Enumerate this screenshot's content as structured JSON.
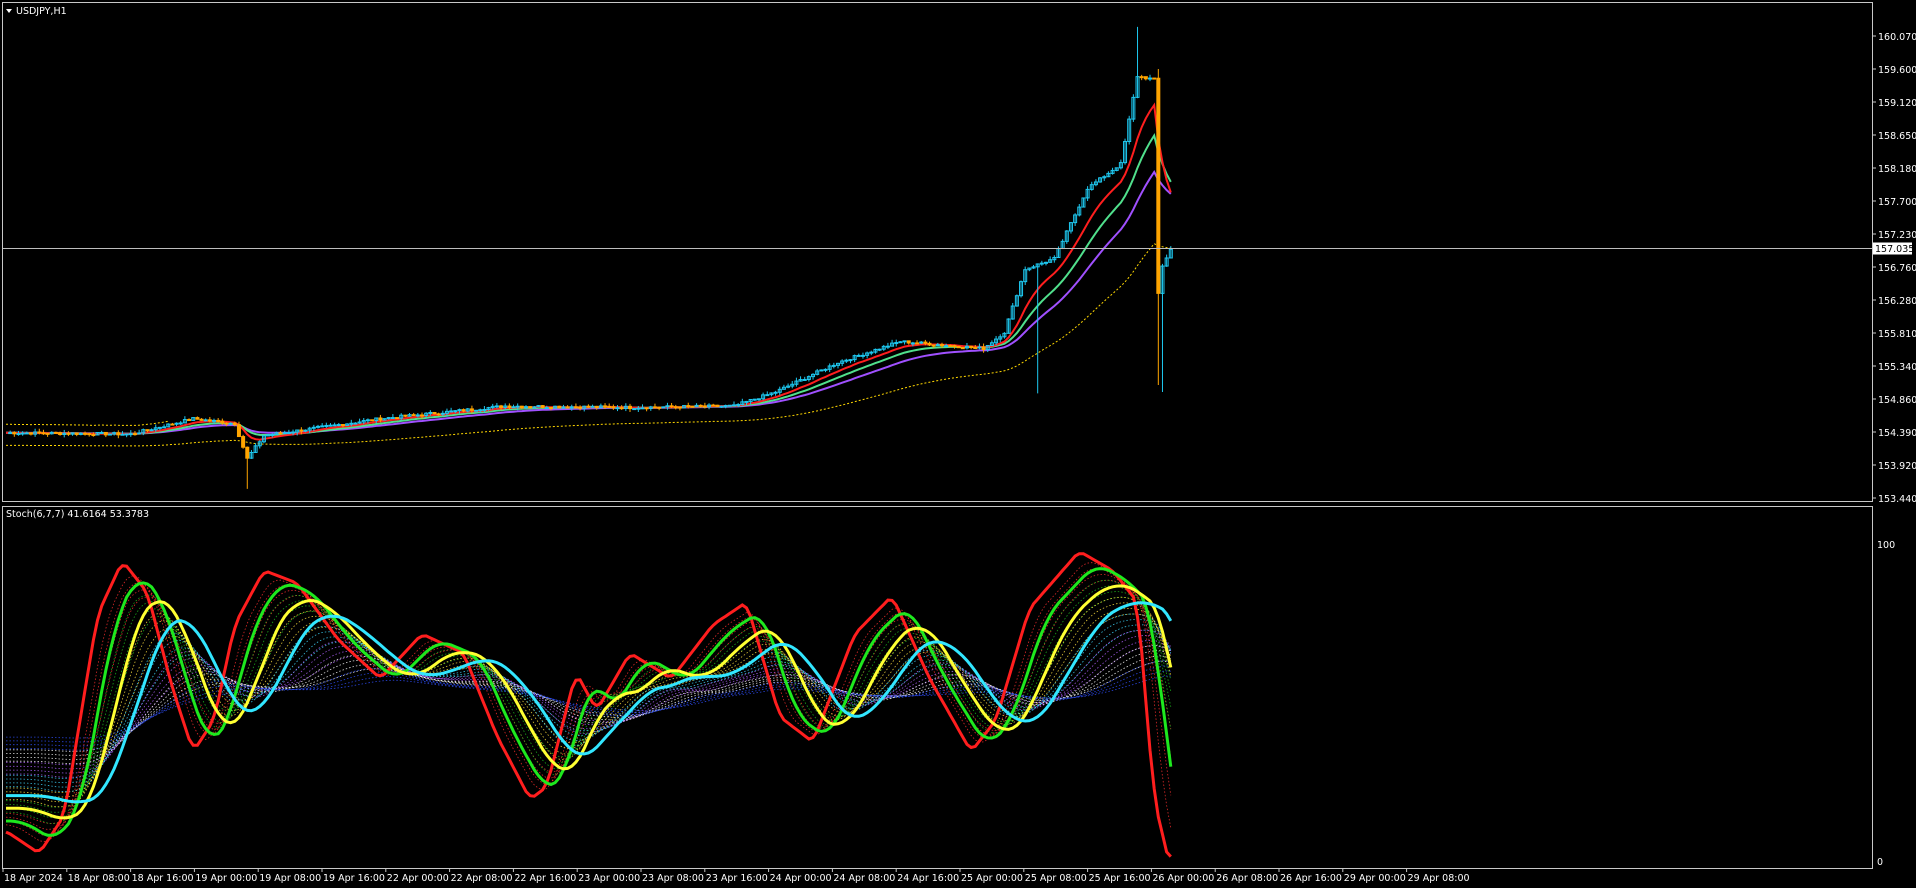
{
  "price_panel": {
    "symbol_label": "USDJPY,H1",
    "current_price": "157.035",
    "y_ticks": [
      "160.070",
      "159.600",
      "159.120",
      "158.650",
      "158.180",
      "157.700",
      "157.230",
      "156.760",
      "156.280",
      "155.810",
      "155.340",
      "154.860",
      "154.390",
      "153.920",
      "153.440"
    ]
  },
  "indicator_panel": {
    "label": "Stoch(6,7,7) 41.6164 53.3783",
    "y_max": "100",
    "y_min": "0"
  },
  "time_axis": [
    "18 Apr 2024",
    "18 Apr 08:00",
    "18 Apr 16:00",
    "19 Apr 00:00",
    "19 Apr 08:00",
    "19 Apr 16:00",
    "22 Apr 00:00",
    "22 Apr 08:00",
    "22 Apr 16:00",
    "23 Apr 00:00",
    "23 Apr 08:00",
    "23 Apr 16:00",
    "24 Apr 00:00",
    "24 Apr 08:00",
    "24 Apr 16:00",
    "25 Apr 00:00",
    "25 Apr 08:00",
    "25 Apr 16:00",
    "26 Apr 00:00",
    "26 Apr 08:00",
    "26 Apr 16:00",
    "29 Apr 00:00",
    "29 Apr 08:00"
  ],
  "colors": {
    "background": "#000000",
    "frame": "#c8c8c8",
    "bull_candle": "#1ec8f0",
    "bear_candle": "#ffa500",
    "ma_fast": "#ff1e1e",
    "ma_mid": "#50e08c",
    "ma_slow": "#a050ff",
    "band": "#ffd700",
    "stoch_red": "#ff1e1e",
    "stoch_green": "#1ee81e",
    "stoch_yellow": "#ffff32",
    "stoch_cyan": "#32e6ff"
  }
}
